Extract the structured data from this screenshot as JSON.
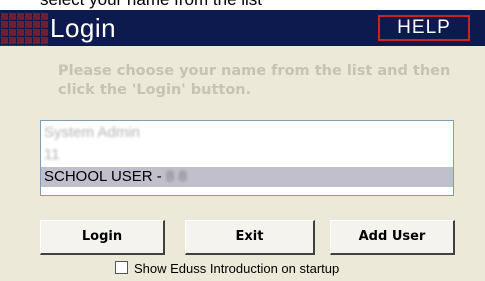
{
  "top_strip": {
    "partial_text": "select your name from the list"
  },
  "title_bar": {
    "title": "Login",
    "help_label": "HELP"
  },
  "instructions": "Please choose your name from the list and then click the 'Login' button.",
  "user_list": {
    "items": [
      {
        "label": "System Admin",
        "blurred": true
      },
      {
        "label": "11",
        "blurred": true
      },
      {
        "label": "SCHOOL USER - ",
        "tail": "8 8",
        "selected": true
      }
    ]
  },
  "buttons": {
    "login": "Login",
    "exit": "Exit",
    "add_user": "Add User"
  },
  "startup_option": {
    "label": "Show Eduss Introduction on startup",
    "checked": false
  },
  "colors": {
    "title_bar": "#0d1a4d",
    "help_border": "#cc2222",
    "selection": "#c0c0cc",
    "window_bg": "#ece9d8"
  }
}
